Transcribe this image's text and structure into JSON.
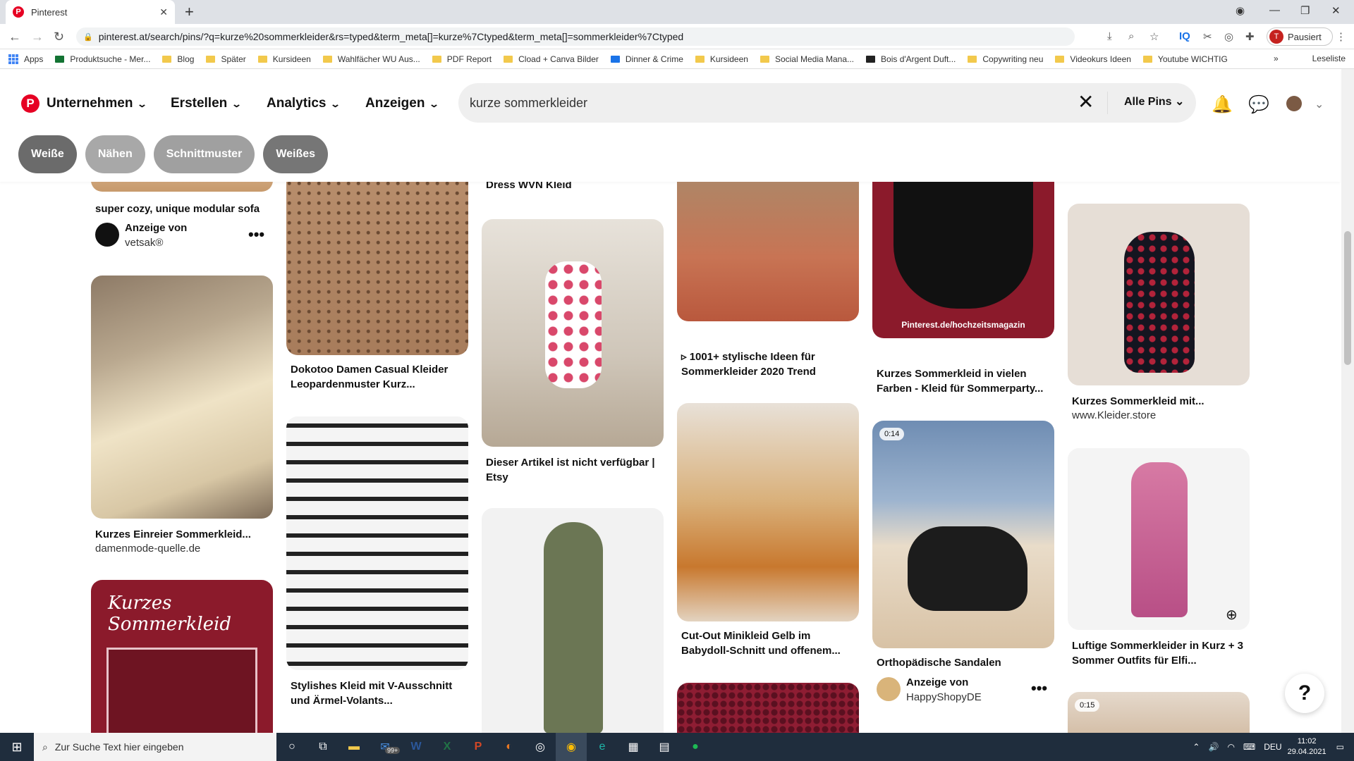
{
  "browser": {
    "tab_title": "Pinterest",
    "url": "pinterest.at/search/pins/?q=kurze%20sommerkleider&rs=typed&term_meta[]=kurze%7Ctyped&term_meta[]=sommerkleider%7Ctyped",
    "profile_label": "Pausiert",
    "profile_initial": "T",
    "bookmarks": [
      "Apps",
      "Produktsuche - Mer...",
      "Blog",
      "Später",
      "Kursideen",
      "Wahlfächer WU Aus...",
      "PDF Report",
      "Cload + Canva Bilder",
      "Dinner & Crime",
      "Kursideen",
      "Social Media Mana...",
      "Bois d'Argent Duft...",
      "Copywriting neu",
      "Videokurs Ideen",
      "Youtube WICHTIG"
    ],
    "reading_list": "Leseliste"
  },
  "header": {
    "menus": [
      "Unternehmen",
      "Erstellen",
      "Analytics",
      "Anzeigen"
    ],
    "search_value": "kurze sommerkleider",
    "filter_label": "Alle Pins",
    "chips": [
      {
        "label": "Weiße",
        "color": "#6b6b6b"
      },
      {
        "label": "Nähen",
        "color": "#a8a8a8"
      },
      {
        "label": "Schnittmuster",
        "color": "#a0a0a0"
      },
      {
        "label": "Weißes",
        "color": "#767676"
      }
    ]
  },
  "pins": {
    "c1_sofa_title": "super cozy, unique modular sofa",
    "c1_sofa_ad": "Anzeige von",
    "c1_sofa_src": "vetsak®",
    "c1_dress_title": "Kurzes Einreier Sommerkleid...",
    "c1_dress_src": "damenmode-quelle.de",
    "c1_banner_text": "Kurzes Sommerkleid",
    "c2_leo_title": "Dokotoo Damen Casual Kleider Leopardenmuster Kurz...",
    "c2_vneck_title": "Stylishes Kleid mit V-Ausschnitt und Ärmel-Volants...",
    "c3_top_title": "Dress WVN Kleid",
    "c3_floral_title": "Dieser Artikel ist nicht verfügbar | Etsy",
    "c4_ideas_title": "▹ 1001+ stylische Ideen für Sommerkleider 2020 Trend",
    "c4_yellow_title": "Cut-Out Minikleid Gelb im Babydoll-Schnitt und offenem...",
    "c5_black_overlay": "Pinterest.de/hochzeitsmagazin",
    "c5_black_title": "Kurzes Sommerkleid in vielen Farben - Kleid für Sommerparty...",
    "c5_sandal_badge": "0:14",
    "c5_sandal_title": "Orthopädische Sandalen",
    "c5_sandal_ad": "Anzeige von",
    "c5_sandal_src": "HappyShopyDE",
    "c6_backless_title": "Kurzes Sommerkleid mit...",
    "c6_backless_src": "www.Kleider.store",
    "c6_pink_title": "Luftige Sommerkleider in Kurz + 3 Sommer Outfits für Elfi...",
    "c6_bottom_badge": "0:15"
  },
  "taskbar": {
    "search_placeholder": "Zur Suche Text hier eingeben",
    "lang": "DEU",
    "time": "11:02",
    "date": "29.04.2021",
    "mail_badge": "99+"
  },
  "colors": {
    "pinterest_red": "#e60023",
    "taskbar": "#1f2d3d"
  }
}
